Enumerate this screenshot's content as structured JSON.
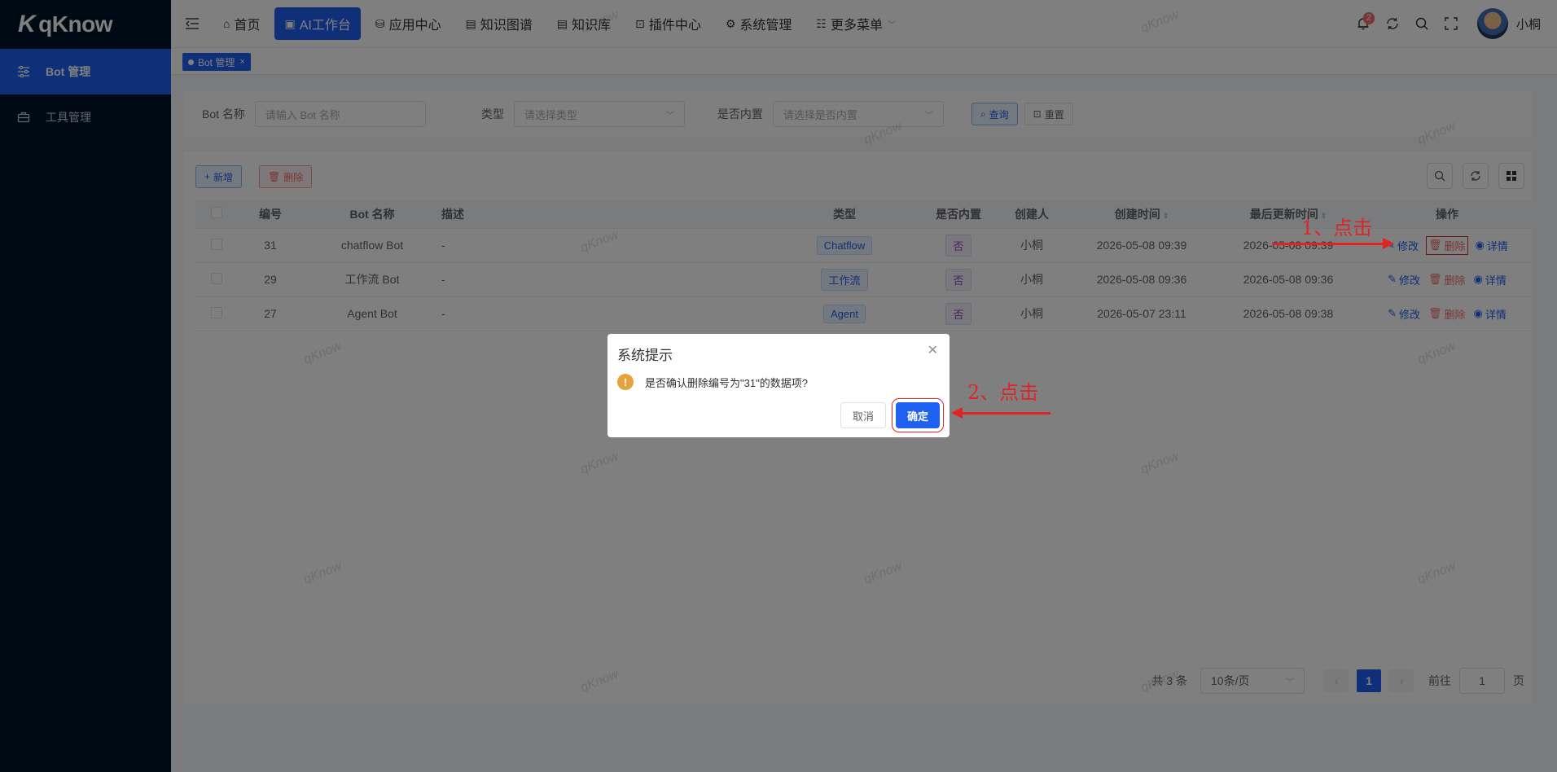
{
  "app": {
    "logo_text": "qKnow",
    "logo_mark": "K"
  },
  "sidebar": {
    "items": [
      {
        "label": "Bot 管理",
        "active": true,
        "icon": "sliders-icon"
      },
      {
        "label": "工具管理",
        "active": false,
        "icon": "toolbox-icon"
      }
    ]
  },
  "topnav": {
    "items": [
      {
        "label": "首页",
        "icon": "home-icon"
      },
      {
        "label": "AI工作台",
        "icon": "monitor-icon",
        "active": true
      },
      {
        "label": "应用中心",
        "icon": "stack-icon"
      },
      {
        "label": "知识图谱",
        "icon": "book-icon"
      },
      {
        "label": "知识库",
        "icon": "library-icon"
      },
      {
        "label": "插件中心",
        "icon": "briefcase-icon"
      },
      {
        "label": "系统管理",
        "icon": "gear-icon"
      },
      {
        "label": "更多菜单",
        "icon": "grid-icon"
      }
    ],
    "badge_count": "2",
    "username": "小桐"
  },
  "tags": {
    "current": "Bot 管理"
  },
  "search": {
    "name_label": "Bot 名称",
    "name_placeholder": "请输入 Bot 名称",
    "type_label": "类型",
    "type_placeholder": "请选择类型",
    "builtin_label": "是否内置",
    "builtin_placeholder": "请选择是否内置",
    "query_label": "查询",
    "reset_label": "重置"
  },
  "toolbar": {
    "add_label": "新增",
    "delete_label": "删除"
  },
  "table": {
    "headers": [
      "编号",
      "Bot 名称",
      "描述",
      "类型",
      "是否内置",
      "创建人",
      "创建时间",
      "最后更新时间",
      "操作"
    ],
    "rows": [
      {
        "id": "31",
        "name": "chatflow Bot",
        "desc": "-",
        "type": "Chatflow",
        "builtin": "否",
        "creator": "小桐",
        "created": "2026-05-08 09:39",
        "updated": "2026-05-08 09:39"
      },
      {
        "id": "29",
        "name": "工作流 Bot",
        "desc": "-",
        "type": "工作流",
        "builtin": "否",
        "creator": "小桐",
        "created": "2026-05-08 09:36",
        "updated": "2026-05-08 09:36"
      },
      {
        "id": "27",
        "name": "Agent Bot",
        "desc": "-",
        "type": "Agent",
        "builtin": "否",
        "creator": "小桐",
        "created": "2026-05-07 23:11",
        "updated": "2026-05-08 09:38"
      }
    ],
    "op_edit": "修改",
    "op_delete": "删除",
    "op_view": "详情"
  },
  "pagination": {
    "total": "共 3 条",
    "page_size": "10条/页",
    "current": "1",
    "goto_label": "前往",
    "goto_value": "1",
    "page_unit": "页"
  },
  "dialog": {
    "title": "系统提示",
    "message": "是否确认删除编号为\"31\"的数据项?",
    "cancel": "取消",
    "confirm": "确定"
  },
  "annotations": {
    "step1": "1、点击",
    "step2": "2、点击"
  },
  "watermark": "qKnow",
  "colors": {
    "primary": "#1e60f0",
    "sidebar": "#001529",
    "danger": "#f56c6c",
    "warning": "#e6a23c",
    "annotation": "#e02424"
  }
}
